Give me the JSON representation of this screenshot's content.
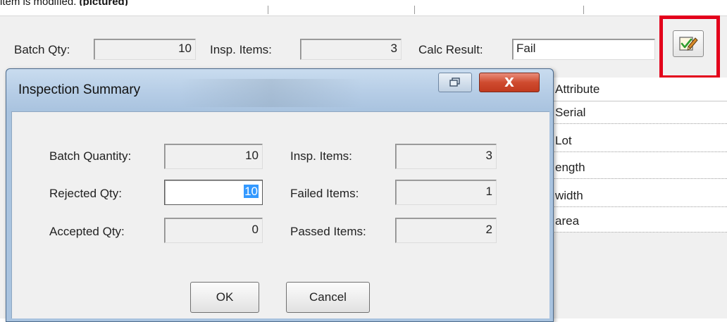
{
  "doc_caption": {
    "prefix": "item is modified.",
    "bold": "(pictured)"
  },
  "toolbar": {
    "batch_qty_label": "Batch Qty:",
    "batch_qty_value": "10",
    "insp_items_label": "Insp. Items:",
    "insp_items_value": "3",
    "calc_result_label": "Calc Result:",
    "calc_result_value": "Fail",
    "calc_button_icon": "edit-check-icon",
    "highlight_color": "#e3001b"
  },
  "attribute_grid": {
    "header": "Attribute",
    "rows": [
      "Serial",
      "Lot",
      "ength",
      "width",
      "area"
    ]
  },
  "dialog": {
    "title": "Inspection Summary",
    "restore_icon": "restore-icon",
    "close_label": "X",
    "fields": {
      "batch_quantity_label": "Batch Quantity:",
      "batch_quantity_value": "10",
      "rejected_qty_label": "Rejected Qty:",
      "rejected_qty_value": "10",
      "accepted_qty_label": "Accepted Qty:",
      "accepted_qty_value": "0",
      "insp_items_label": "Insp. Items:",
      "insp_items_value": "3",
      "failed_items_label": "Failed Items:",
      "failed_items_value": "1",
      "passed_items_label": "Passed Items:",
      "passed_items_value": "2"
    },
    "ok_label": "OK",
    "cancel_label": "Cancel"
  },
  "colors": {
    "dialog_frame": "#a9c3df",
    "close_button": "#c23a1f",
    "selection": "#3399ff"
  }
}
